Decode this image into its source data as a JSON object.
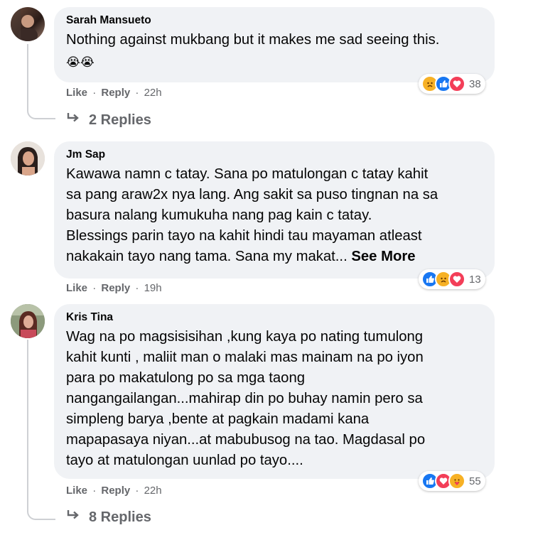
{
  "comments": [
    {
      "author": "Sarah Mansueto",
      "text": "Nothing against mukbang but it makes me sad seeing this.",
      "emoji": "😭😭",
      "actions": {
        "like": "Like",
        "reply": "Reply",
        "time": "22h"
      },
      "reaction_count": "38",
      "reaction_icons": [
        "sad",
        "like",
        "love"
      ],
      "replies_label": "2 Replies"
    },
    {
      "author": "Jm Sap",
      "lines": [
        "Kawawa namn c tatay. Sana po matulongan c tatay kahit",
        "sa pang araw2x nya lang. Ang sakit sa puso tingnan na sa",
        "basura nalang kumukuha nang pag kain c tatay.",
        "Blessings parin tayo na kahit hindi tau mayaman atleast",
        "nakakain tayo nang tama. Sana my makat..."
      ],
      "see_more": "See More",
      "actions": {
        "like": "Like",
        "reply": "Reply",
        "time": "19h"
      },
      "reaction_count": "13",
      "reaction_icons": [
        "like",
        "sad",
        "love"
      ]
    },
    {
      "author": "Kris Tina",
      "lines": [
        "Wag na po magsisisihan ,kung kaya po nating tumulong",
        "kahit kunti , maliit man o malaki mas mainam na po iyon",
        "para po makatulong po sa mga taong",
        "nangangailangan...mahirap din po buhay namin pero sa",
        "simpleng barya ,bente at pagkain madami kana",
        "mapapasaya niyan...at mabubusog na tao. Magdasal po",
        "tayo at matulongan uunlad po tayo...."
      ],
      "actions": {
        "like": "Like",
        "reply": "Reply",
        "time": "22h"
      },
      "reaction_count": "55",
      "reaction_icons": [
        "like",
        "love",
        "care"
      ],
      "replies_label": "8 Replies"
    }
  ],
  "separator": "·",
  "colors": {
    "bubble": "#f0f2f5",
    "secondary_text": "#65676b",
    "like_blue": "#1877f2",
    "love_red": "#f33e58",
    "sad_yellow": "#f7b125"
  }
}
